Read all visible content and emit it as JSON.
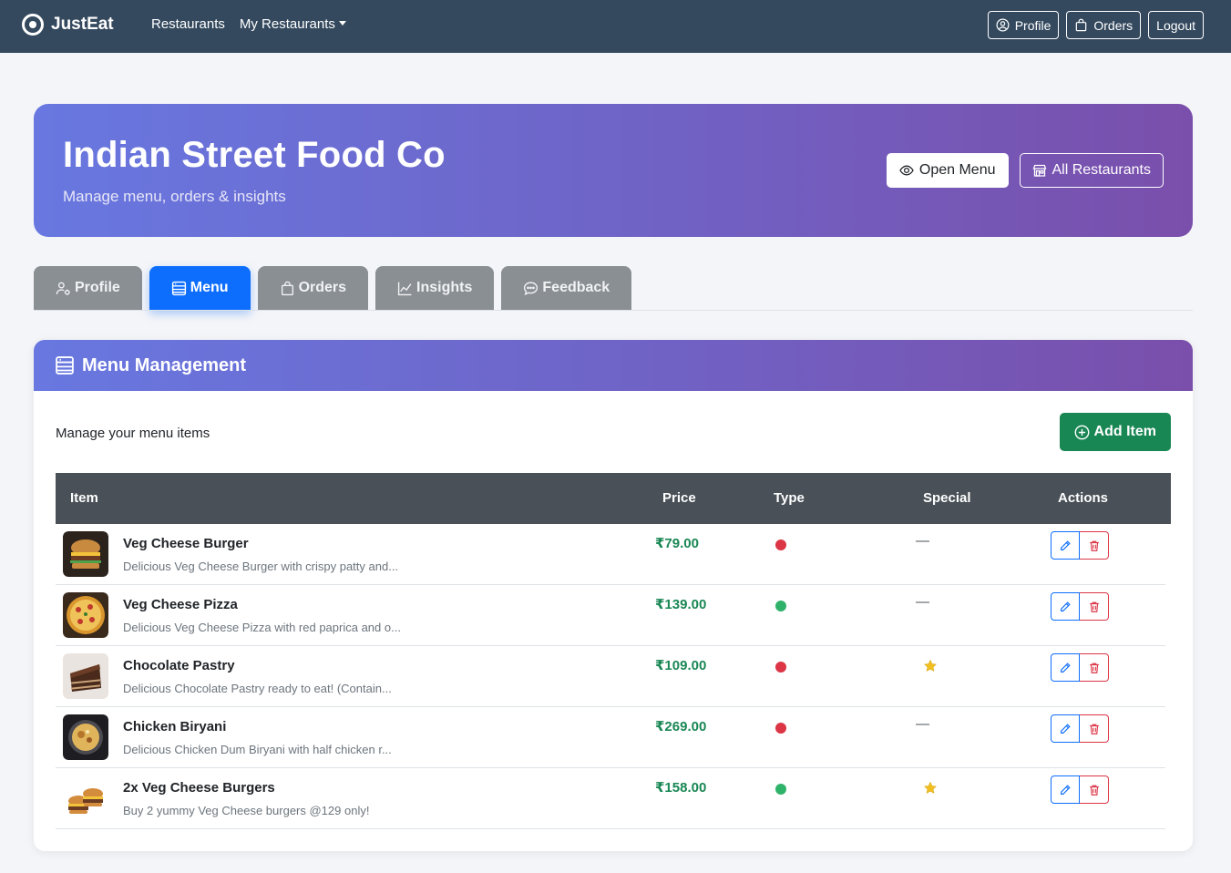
{
  "navbar": {
    "brand": "JustEat",
    "links": [
      "Restaurants",
      "My Restaurants"
    ],
    "buttons": {
      "profile": "Profile",
      "orders": "Orders",
      "logout": "Logout"
    }
  },
  "hero": {
    "title": "Indian Street Food Co",
    "subtitle": "Manage menu, orders & insights",
    "open_menu": "Open Menu",
    "all_restaurants": "All Restaurants"
  },
  "tabs": [
    {
      "label": "Profile",
      "icon": "person-gear-icon"
    },
    {
      "label": "Menu",
      "icon": "menu-list-icon",
      "active": true
    },
    {
      "label": "Orders",
      "icon": "bag-icon"
    },
    {
      "label": "Insights",
      "icon": "chart-line-icon"
    },
    {
      "label": "Feedback",
      "icon": "chat-dots-icon"
    }
  ],
  "menu": {
    "header": "Menu Management",
    "subtitle": "Manage your menu items",
    "add_item": "Add Item",
    "columns": {
      "item": "Item",
      "price": "Price",
      "type": "Type",
      "special": "Special",
      "actions": "Actions"
    },
    "items": [
      {
        "name": "Veg Cheese Burger",
        "description": "Delicious Veg Cheese Burger with crispy patty and...",
        "price": "₹79.00",
        "type_color": "#dc3545",
        "special": "—",
        "is_special": false
      },
      {
        "name": "Veg Cheese Pizza",
        "description": "Delicious Veg Cheese Pizza with red paprica and o...",
        "price": "₹139.00",
        "type_color": "#2fb36b",
        "special": "—",
        "is_special": false
      },
      {
        "name": "Chocolate Pastry",
        "description": "Delicious Chocolate Pastry ready to eat! (Contain...",
        "price": "₹109.00",
        "type_color": "#dc3545",
        "special": "",
        "is_special": true
      },
      {
        "name": "Chicken Biryani",
        "description": "Delicious Chicken Dum Biryani with half chicken r...",
        "price": "₹269.00",
        "type_color": "#dc3545",
        "special": "—",
        "is_special": false
      },
      {
        "name": "2x Veg Cheese Burgers",
        "description": "Buy 2 yummy Veg Cheese burgers @129 only!",
        "price": "₹158.00",
        "type_color": "#2fb36b",
        "special": "",
        "is_special": true
      }
    ]
  },
  "colors": {
    "navbar": "#34495e",
    "accent": "#0d6efd",
    "success": "#198754",
    "danger": "#dc3545",
    "star": "#f2c01e"
  }
}
